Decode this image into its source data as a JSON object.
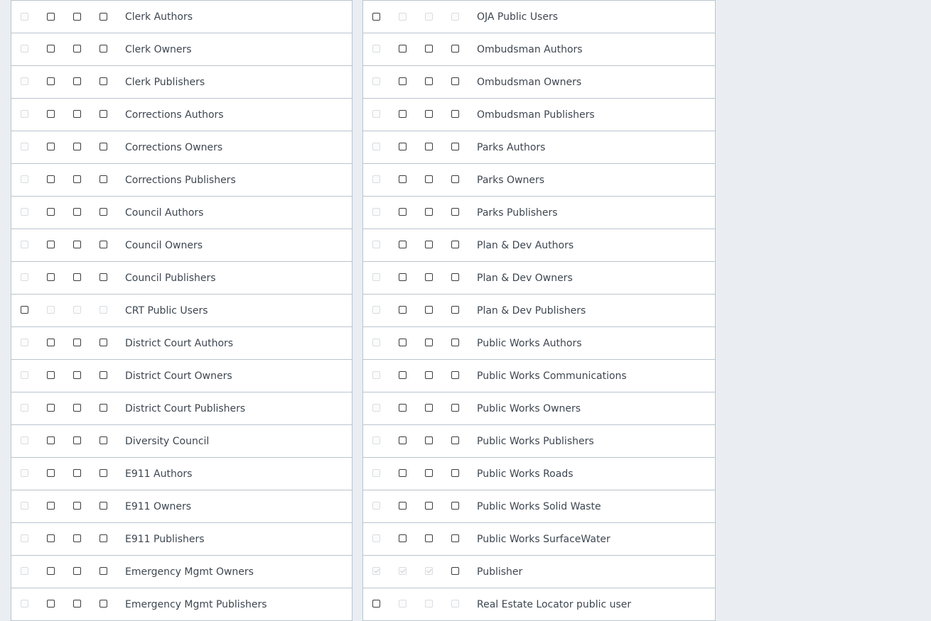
{
  "left_rows": [
    {
      "label": "Clerk Authors",
      "boxes": [
        "d",
        "e",
        "e",
        "e"
      ]
    },
    {
      "label": "Clerk Owners",
      "boxes": [
        "d",
        "e",
        "e",
        "e"
      ]
    },
    {
      "label": "Clerk Publishers",
      "boxes": [
        "d",
        "e",
        "e",
        "e"
      ]
    },
    {
      "label": "Corrections Authors",
      "boxes": [
        "d",
        "e",
        "e",
        "e"
      ]
    },
    {
      "label": "Corrections Owners",
      "boxes": [
        "d",
        "e",
        "e",
        "e"
      ]
    },
    {
      "label": "Corrections Publishers",
      "boxes": [
        "d",
        "e",
        "e",
        "e"
      ]
    },
    {
      "label": "Council Authors",
      "boxes": [
        "d",
        "e",
        "e",
        "e"
      ]
    },
    {
      "label": "Council Owners",
      "boxes": [
        "d",
        "e",
        "e",
        "e"
      ]
    },
    {
      "label": "Council Publishers",
      "boxes": [
        "d",
        "e",
        "e",
        "e"
      ]
    },
    {
      "label": "CRT Public Users",
      "boxes": [
        "e",
        "d",
        "d",
        "d"
      ]
    },
    {
      "label": "District Court Authors",
      "boxes": [
        "d",
        "e",
        "e",
        "e"
      ]
    },
    {
      "label": "District Court Owners",
      "boxes": [
        "d",
        "e",
        "e",
        "e"
      ]
    },
    {
      "label": "District Court Publishers",
      "boxes": [
        "d",
        "e",
        "e",
        "e"
      ]
    },
    {
      "label": "Diversity Council",
      "boxes": [
        "d",
        "e",
        "e",
        "e"
      ]
    },
    {
      "label": "E911 Authors",
      "boxes": [
        "d",
        "e",
        "e",
        "e"
      ]
    },
    {
      "label": "E911 Owners",
      "boxes": [
        "d",
        "e",
        "e",
        "e"
      ]
    },
    {
      "label": "E911 Publishers",
      "boxes": [
        "d",
        "e",
        "e",
        "e"
      ]
    },
    {
      "label": "Emergency Mgmt Owners",
      "boxes": [
        "d",
        "e",
        "e",
        "e"
      ]
    },
    {
      "label": "Emergency Mgmt Publishers",
      "boxes": [
        "d",
        "e",
        "e",
        "e"
      ]
    }
  ],
  "right_rows": [
    {
      "label": "OJA Public Users",
      "boxes": [
        "e",
        "d",
        "d",
        "d"
      ]
    },
    {
      "label": "Ombudsman Authors",
      "boxes": [
        "d",
        "e",
        "e",
        "e"
      ]
    },
    {
      "label": "Ombudsman Owners",
      "boxes": [
        "d",
        "e",
        "e",
        "e"
      ]
    },
    {
      "label": "Ombudsman Publishers",
      "boxes": [
        "d",
        "e",
        "e",
        "e"
      ]
    },
    {
      "label": "Parks Authors",
      "boxes": [
        "d",
        "e",
        "e",
        "e"
      ]
    },
    {
      "label": "Parks Owners",
      "boxes": [
        "d",
        "e",
        "e",
        "e"
      ]
    },
    {
      "label": "Parks Publishers",
      "boxes": [
        "d",
        "e",
        "e",
        "e"
      ]
    },
    {
      "label": "Plan & Dev Authors",
      "boxes": [
        "d",
        "e",
        "e",
        "e"
      ]
    },
    {
      "label": "Plan & Dev Owners",
      "boxes": [
        "d",
        "e",
        "e",
        "e"
      ]
    },
    {
      "label": "Plan & Dev Publishers",
      "boxes": [
        "d",
        "e",
        "e",
        "e"
      ]
    },
    {
      "label": "Public Works Authors",
      "boxes": [
        "d",
        "e",
        "e",
        "e"
      ]
    },
    {
      "label": "Public Works Communications",
      "boxes": [
        "d",
        "e",
        "e",
        "e"
      ]
    },
    {
      "label": "Public Works Owners",
      "boxes": [
        "d",
        "e",
        "e",
        "e"
      ]
    },
    {
      "label": "Public Works Publishers",
      "boxes": [
        "d",
        "e",
        "e",
        "e"
      ]
    },
    {
      "label": "Public Works Roads",
      "boxes": [
        "d",
        "e",
        "e",
        "e"
      ]
    },
    {
      "label": "Public Works Solid Waste",
      "boxes": [
        "d",
        "e",
        "e",
        "e"
      ]
    },
    {
      "label": "Public Works SurfaceWater",
      "boxes": [
        "d",
        "e",
        "e",
        "e"
      ]
    },
    {
      "label": "Publisher",
      "boxes": [
        "dc",
        "dc",
        "dc",
        "e"
      ]
    },
    {
      "label": "Real Estate Locator public user",
      "boxes": [
        "e",
        "d",
        "d",
        "d"
      ]
    }
  ]
}
